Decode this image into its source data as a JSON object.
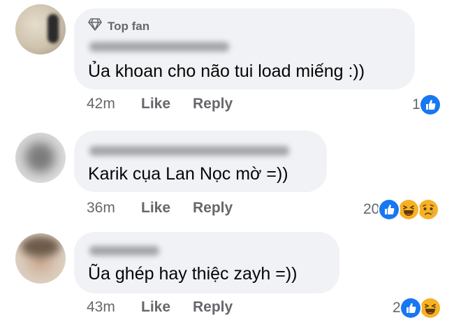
{
  "comments": [
    {
      "badge": "Top fan",
      "text": "Ủa khoan cho não tui load miếng :))",
      "time": "42m",
      "like": "Like",
      "reply": "Reply",
      "reaction_count": "1",
      "reactions": [
        "like-icon"
      ]
    },
    {
      "text": "Karik cụa Lan Nọc mờ =))",
      "time": "36m",
      "like": "Like",
      "reply": "Reply",
      "reaction_count": "20",
      "reactions": [
        "like-icon",
        "haha-icon",
        "sad-icon"
      ]
    },
    {
      "text": "Ũa ghép hay thiệc zayh =))",
      "time": "43m",
      "like": "Like",
      "reply": "Reply",
      "reaction_count": "2",
      "reactions": [
        "like-icon",
        "haha-icon"
      ]
    }
  ],
  "colors": {
    "bubble": "#f0f2f5",
    "meta": "#65676b",
    "like_blue": "#1877f2",
    "haha_yellow": "#f7b125"
  }
}
